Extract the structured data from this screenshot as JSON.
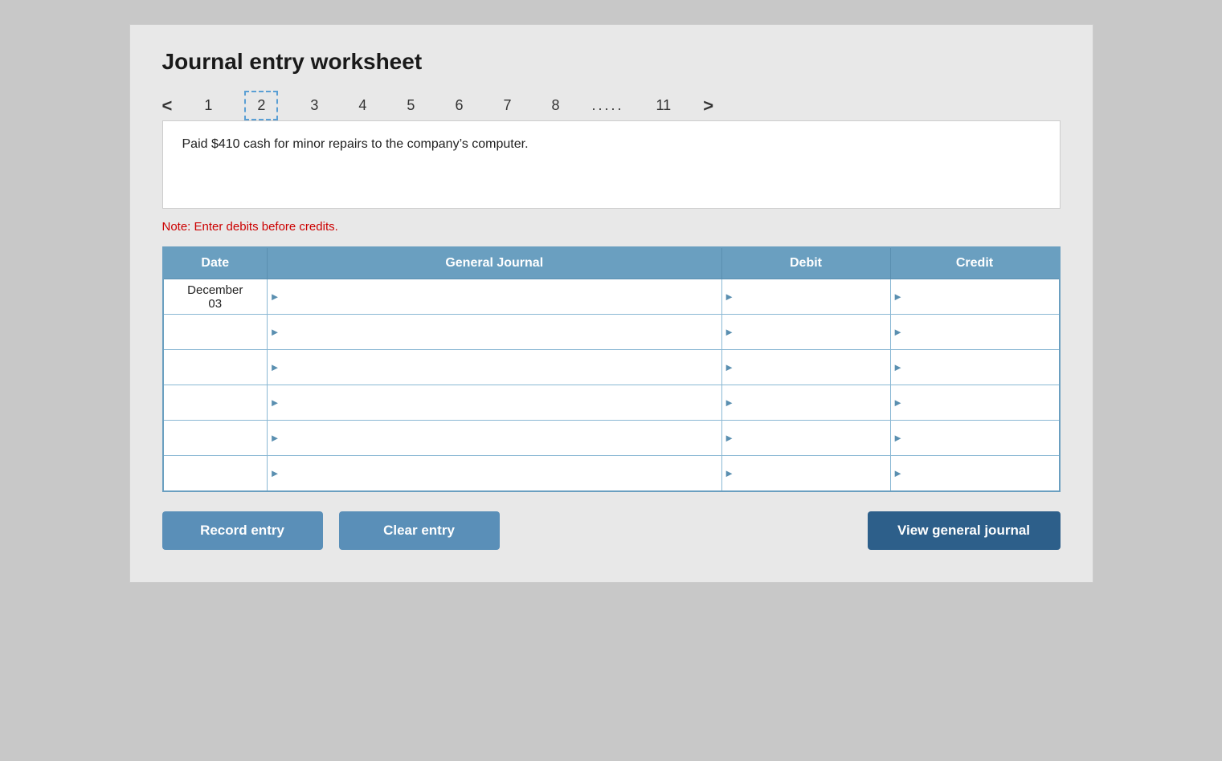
{
  "header": {
    "title": "Journal entry worksheet"
  },
  "pagination": {
    "prev_arrow": "<",
    "next_arrow": ">",
    "items": [
      {
        "label": "1",
        "active": false
      },
      {
        "label": "2",
        "active": true
      },
      {
        "label": "3",
        "active": false
      },
      {
        "label": "4",
        "active": false
      },
      {
        "label": "5",
        "active": false
      },
      {
        "label": "6",
        "active": false
      },
      {
        "label": "7",
        "active": false
      },
      {
        "label": "8",
        "active": false
      },
      {
        "label": ".....",
        "active": false,
        "dots": true
      },
      {
        "label": "11",
        "active": false
      }
    ]
  },
  "description": "Paid $410 cash for minor repairs to the company’s computer.",
  "note": "Note: Enter debits before credits.",
  "table": {
    "headers": [
      "Date",
      "General Journal",
      "Debit",
      "Credit"
    ],
    "rows": [
      {
        "date": "December\n03",
        "journal": "",
        "debit": "",
        "credit": ""
      },
      {
        "date": "",
        "journal": "",
        "debit": "",
        "credit": ""
      },
      {
        "date": "",
        "journal": "",
        "debit": "",
        "credit": ""
      },
      {
        "date": "",
        "journal": "",
        "debit": "",
        "credit": ""
      },
      {
        "date": "",
        "journal": "",
        "debit": "",
        "credit": ""
      },
      {
        "date": "",
        "journal": "",
        "debit": "",
        "credit": ""
      }
    ]
  },
  "buttons": {
    "record_entry": "Record entry",
    "clear_entry": "Clear entry",
    "view_journal": "View general journal"
  }
}
